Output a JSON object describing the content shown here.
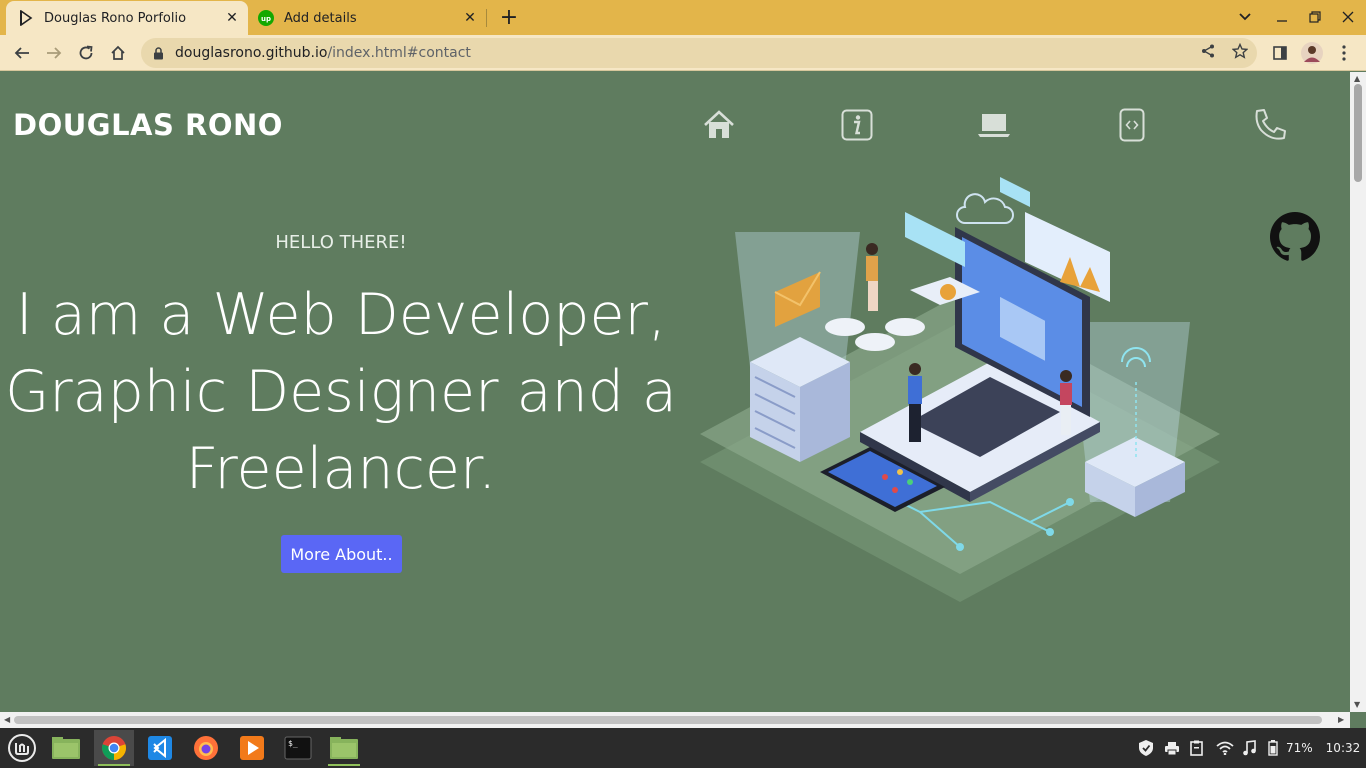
{
  "browser": {
    "tabs": [
      {
        "title": "Douglas Rono Porfolio",
        "active": true
      },
      {
        "title": "Add details",
        "active": false
      }
    ],
    "url_host": "douglasrono.github.io",
    "url_path": "/index.html#contact"
  },
  "site": {
    "brand": "DOUGLAS RONO",
    "nav_icons": [
      "home-icon",
      "info-icon",
      "laptop-icon",
      "code-icon",
      "phone-icon"
    ],
    "greeting": "HELLO THERE!",
    "headline_lines": [
      "I am a Web Developer,",
      "Graphic Designer and a",
      "Freelancer."
    ],
    "cta_label": "More About.."
  },
  "taskbar": {
    "apps": [
      "mint-menu-icon",
      "files-icon",
      "chrome-icon",
      "vscode-icon",
      "firefox-icon",
      "media-player-icon",
      "terminal-icon",
      "folder-icon"
    ],
    "battery": "71%",
    "clock": "10:32"
  },
  "colors": {
    "tab_bar": "#e3b54a",
    "page_bg": "#5f7c5f",
    "cta": "#5a67f5"
  }
}
